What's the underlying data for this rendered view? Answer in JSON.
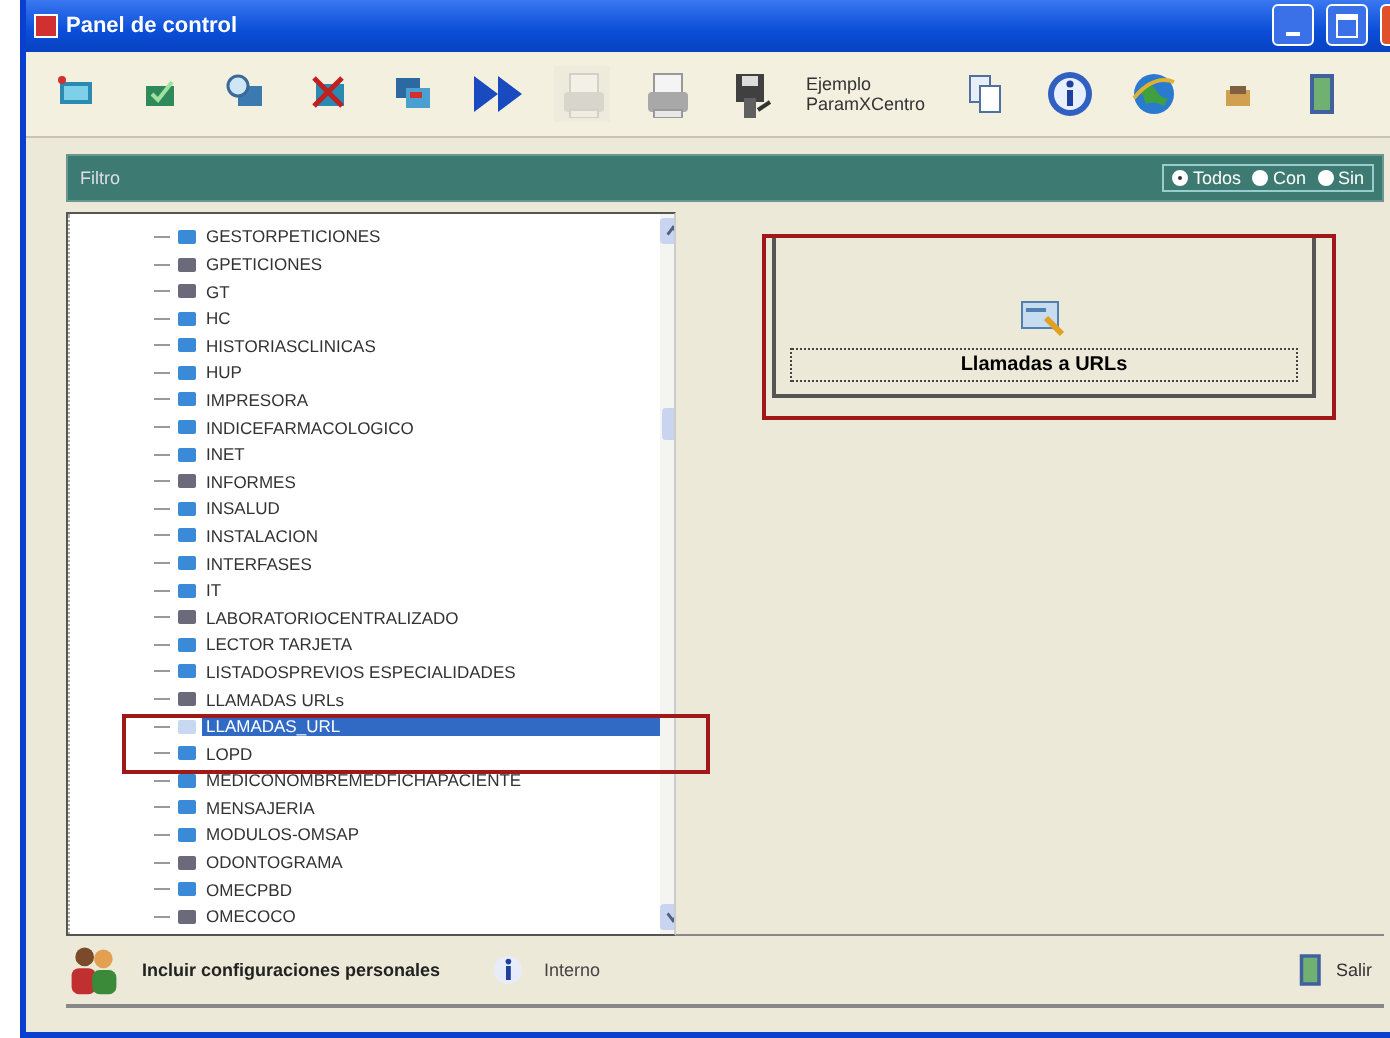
{
  "window": {
    "title": "Panel de control"
  },
  "toolbar": [
    {
      "kind": "image"
    },
    {
      "kind": "check"
    },
    {
      "kind": "search"
    },
    {
      "kind": "delete"
    },
    {
      "kind": "copy"
    },
    {
      "kind": "forward"
    },
    {
      "kind": "printer",
      "disabled": true
    },
    {
      "kind": "printer",
      "disabled": false
    },
    {
      "kind": "disk"
    },
    {
      "kind": "text",
      "label": "Ejemplo ParamXCentro"
    },
    {
      "kind": "pages"
    },
    {
      "kind": "info"
    },
    {
      "kind": "globe"
    },
    {
      "kind": "folder"
    },
    {
      "kind": "exit"
    }
  ],
  "filter": {
    "label": "Filtro",
    "options": [
      {
        "label": "Todos",
        "selected": true
      },
      {
        "label": "Con",
        "selected": false
      },
      {
        "label": "Sin",
        "selected": false
      }
    ]
  },
  "tree": {
    "items": [
      {
        "label": "GESTORPETICIONES",
        "kind": "light",
        "selected": false
      },
      {
        "label": "GPETICIONES",
        "kind": "dark",
        "selected": false
      },
      {
        "label": "GT",
        "kind": "dark",
        "selected": false
      },
      {
        "label": "HC",
        "kind": "light",
        "selected": false
      },
      {
        "label": "HISTORIASCLINICAS",
        "kind": "light",
        "selected": false
      },
      {
        "label": "HUP",
        "kind": "light",
        "selected": false
      },
      {
        "label": "IMPRESORA",
        "kind": "light",
        "selected": false
      },
      {
        "label": "INDICEFARMACOLOGICO",
        "kind": "light",
        "selected": false
      },
      {
        "label": "INET",
        "kind": "light",
        "selected": false
      },
      {
        "label": "INFORMES",
        "kind": "dark",
        "selected": false
      },
      {
        "label": "INSALUD",
        "kind": "light",
        "selected": false
      },
      {
        "label": "INSTALACION",
        "kind": "light",
        "selected": false
      },
      {
        "label": "INTERFASES",
        "kind": "light",
        "selected": false
      },
      {
        "label": "IT",
        "kind": "light",
        "selected": false
      },
      {
        "label": "LABORATORIOCENTRALIZADO",
        "kind": "dark",
        "selected": false
      },
      {
        "label": "LECTOR TARJETA",
        "kind": "light",
        "selected": false
      },
      {
        "label": "LISTADOSPREVIOS ESPECIALIDADES",
        "kind": "light",
        "selected": false
      },
      {
        "label": "LLAMADAS URLs",
        "kind": "dark",
        "selected": false
      },
      {
        "label": "LLAMADAS_URL",
        "kind": "light",
        "selected": true
      },
      {
        "label": "LOPD",
        "kind": "light",
        "selected": false
      },
      {
        "label": "MEDICONOMBREMEDFICHAPACIENTE",
        "kind": "light",
        "selected": false
      },
      {
        "label": "MENSAJERIA",
        "kind": "light",
        "selected": false
      },
      {
        "label": "MODULOS-OMSAP",
        "kind": "light",
        "selected": false
      },
      {
        "label": "ODONTOGRAMA",
        "kind": "dark",
        "selected": false
      },
      {
        "label": "OMECPBD",
        "kind": "light",
        "selected": false
      },
      {
        "label": "OMECOCO",
        "kind": "dark",
        "selected": false
      }
    ]
  },
  "options_panel": {
    "buttons": [
      {
        "label": "Llamadas a URLs"
      }
    ]
  },
  "footer": {
    "personal": "Incluir configuraciones personales",
    "internal": "Interno",
    "exit": "Salir"
  }
}
